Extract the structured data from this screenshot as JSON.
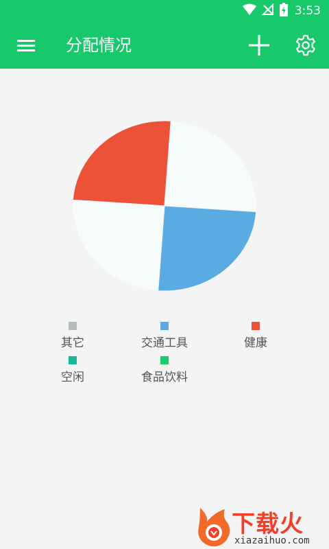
{
  "status_bar": {
    "time": "3:53"
  },
  "app_bar": {
    "title": "分配情况"
  },
  "chart_data": {
    "type": "pie",
    "categories": [
      "健康",
      "其它",
      "交通工具",
      "空闲"
    ],
    "values": [
      25,
      25,
      25,
      25
    ],
    "colors": [
      "#ec5238",
      "#f6fbfb",
      "#5aabe2",
      "#f6fbfb"
    ],
    "legend_placement": "bottom"
  },
  "legend": {
    "items": [
      {
        "label": "其它",
        "color": "#b6bcbc"
      },
      {
        "label": "交通工具",
        "color": "#5aabe2"
      },
      {
        "label": "健康",
        "color": "#ec5238"
      },
      {
        "label": "空闲",
        "color": "#18b998"
      },
      {
        "label": "食品饮料",
        "color": "#21c96d"
      }
    ]
  },
  "watermark": {
    "logo_text": "下载火",
    "url": "xiazaihuo.com"
  }
}
